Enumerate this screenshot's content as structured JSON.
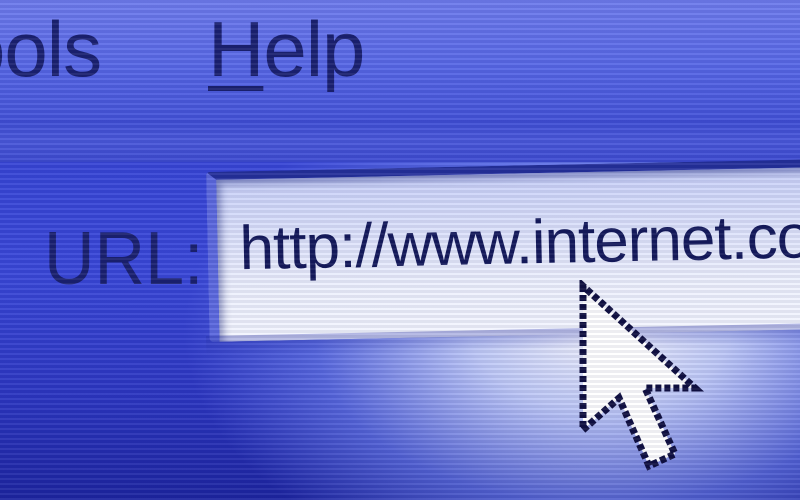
{
  "menu": {
    "tools_label": "ools",
    "help_mnemonic": "H",
    "help_rest": "elp"
  },
  "address_bar": {
    "label": "URL:",
    "value": "http://www.internet.com"
  },
  "cursor": {
    "icon": "arrow-pointer-icon"
  },
  "colors": {
    "background": "#2a35c8",
    "text": "#1b2170",
    "field": "#eef1fd"
  }
}
